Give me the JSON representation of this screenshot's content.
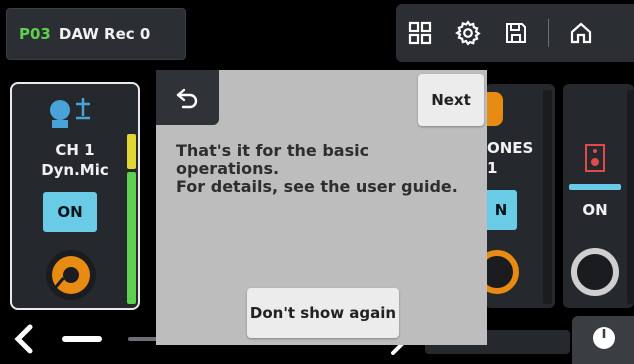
{
  "header": {
    "preset_number": "P03",
    "preset_name": "DAW Rec 0"
  },
  "toolbar": {
    "icons": [
      "grid-icon",
      "gear-icon",
      "save-icon",
      "home-icon"
    ]
  },
  "channel_left": {
    "line1": "CH 1",
    "line2": "Dyn.Mic",
    "on_label": "ON"
  },
  "channel_right1": {
    "line1": "ONES",
    "line2": "1",
    "on_label": "N"
  },
  "channel_right2": {
    "on_label": "ON"
  },
  "dialog": {
    "next_label": "Next",
    "message_line1": "That's it for the basic",
    "message_line2": "operations.",
    "message_line3": "For details, see the user guide.",
    "dont_show_label": "Don't show again"
  },
  "colors": {
    "accent_green": "#5bd14f",
    "on_blue": "#69cbe6",
    "knob_orange": "#e88b12",
    "dialog_bg": "#bdbdbd"
  }
}
